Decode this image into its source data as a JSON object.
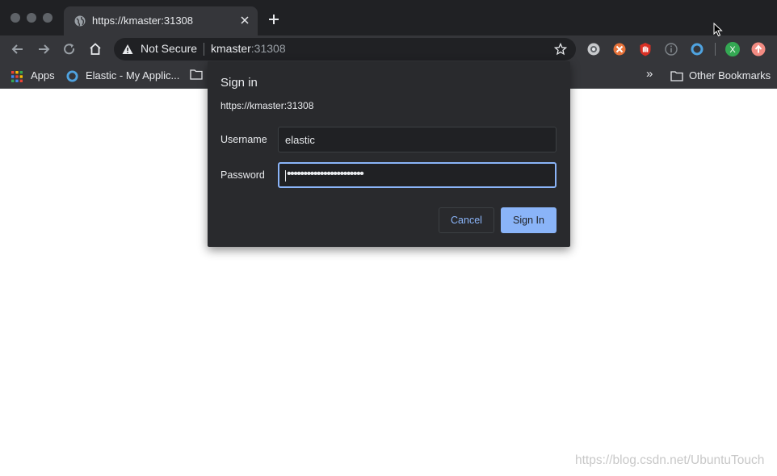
{
  "browser": {
    "tab": {
      "title": "https://kmaster:31308"
    },
    "omnibox": {
      "security_label": "Not Secure",
      "host": "kmaster",
      "port": ":31308"
    },
    "extensions": [
      {
        "icon": "grey-circle-extension-icon",
        "color": "#c7c9cc"
      },
      {
        "icon": "orange-extension-icon",
        "color": "#e8733a"
      },
      {
        "icon": "red-hand-extension-icon",
        "color": "#d93025"
      },
      {
        "icon": "info-extension-icon",
        "color": "#80868b"
      },
      {
        "icon": "blue-ring-extension-icon",
        "color": "#4fa3e0"
      },
      {
        "icon": "profile-avatar",
        "label": "X",
        "color": "#34a853"
      },
      {
        "icon": "update-icon",
        "color": "#f28b82"
      }
    ],
    "bookmarks": {
      "apps": "Apps",
      "elastic": "Elastic - My Applic...",
      "overflow": "»",
      "other": "Other Bookmarks"
    }
  },
  "dialog": {
    "title": "Sign in",
    "origin": "https://kmaster:31308",
    "username_label": "Username",
    "username_value": "elastic",
    "password_label": "Password",
    "password_masked": "•••••••••••••••••••••••",
    "cancel_label": "Cancel",
    "signin_label": "Sign In"
  },
  "watermark": "https://blog.csdn.net/UbuntuTouch",
  "colors": {
    "tabstrip": "#202124",
    "toolbar": "#35363a",
    "dialog": "#292a2d",
    "accent": "#8ab4f8"
  }
}
